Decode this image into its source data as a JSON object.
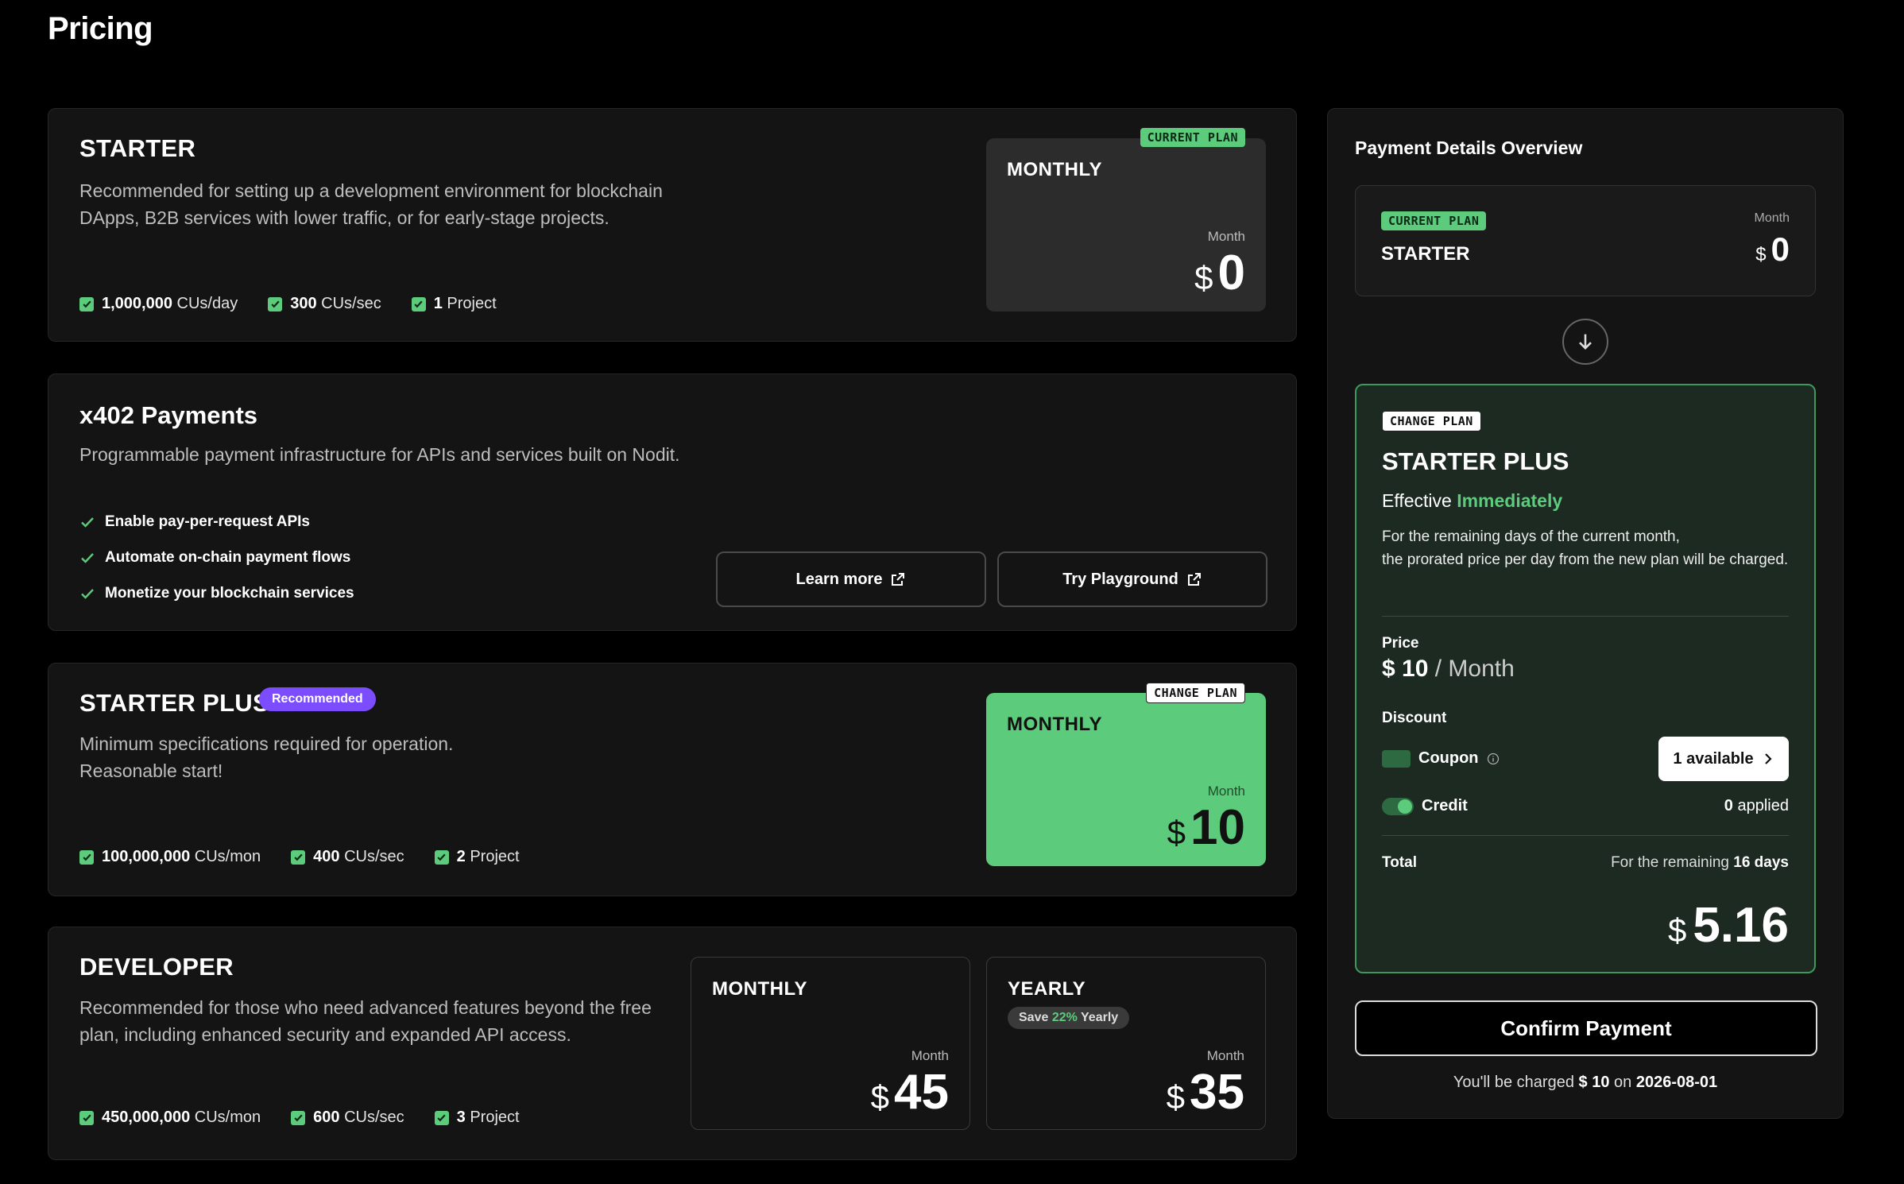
{
  "page": {
    "title": "Pricing"
  },
  "starter": {
    "title": "STARTER",
    "description": "Recommended for setting up a development environment for blockchain DApps, B2B services with lower traffic, or for early-stage projects.",
    "features": [
      {
        "strong": "1,000,000",
        "rest": " CUs/day"
      },
      {
        "strong": "300",
        "rest": " CUs/sec"
      },
      {
        "strong": "1",
        "rest": " Project"
      }
    ],
    "tag": "CURRENT PLAN",
    "period": "MONTHLY",
    "unit": "Month",
    "currency": "$",
    "price": "0"
  },
  "x402": {
    "title": "x402 Payments",
    "description": "Programmable payment infrastructure for APIs and services built on Nodit.",
    "items": [
      "Enable pay-per-request APIs",
      "Automate on-chain payment flows",
      "Monetize your blockchain services"
    ],
    "learn_more": "Learn more",
    "try_playground": "Try Playground"
  },
  "starter_plus": {
    "title": "STARTER PLUS",
    "badge": "Recommended",
    "description_line1": "Minimum specifications required for operation.",
    "description_line2": "Reasonable start!",
    "features": [
      {
        "strong": "100,000,000",
        "rest": " CUs/mon"
      },
      {
        "strong": "400",
        "rest": " CUs/sec"
      },
      {
        "strong": "2",
        "rest": " Project"
      }
    ],
    "tag": "CHANGE PLAN",
    "period": "MONTHLY",
    "unit": "Month",
    "currency": "$",
    "price": "10"
  },
  "developer": {
    "title": "DEVELOPER",
    "description": "Recommended for those who need advanced features beyond the free plan, including enhanced security and expanded API access.",
    "features": [
      {
        "strong": "450,000,000",
        "rest": " CUs/mon"
      },
      {
        "strong": "600",
        "rest": " CUs/sec"
      },
      {
        "strong": "3",
        "rest": " Project"
      }
    ],
    "monthly": {
      "period": "MONTHLY",
      "unit": "Month",
      "currency": "$",
      "price": "45"
    },
    "yearly": {
      "period": "YEARLY",
      "save_prefix": "Save ",
      "save_pct": "22%",
      "save_suffix": " Yearly",
      "unit": "Month",
      "currency": "$",
      "price": "35"
    }
  },
  "summary": {
    "title": "Payment Details Overview",
    "current": {
      "tag": "CURRENT PLAN",
      "plan": "STARTER",
      "unit": "Month",
      "currency": "$",
      "price": "0"
    },
    "change": {
      "tag": "CHANGE PLAN",
      "plan": "STARTER PLUS",
      "effective_label": "Effective",
      "effective_value": "Immediately",
      "note_line1": "For the remaining days of the current month,",
      "note_line2": "the prorated price per day from the new plan will be charged.",
      "price_label": "Price",
      "price_currency": "$",
      "price_value": "10",
      "price_period": "/ Month",
      "discount_label": "Discount",
      "coupon_label": "Coupon",
      "coupon_button": "1 available",
      "credit_label": "Credit",
      "credit_value": "0",
      "credit_suffix": "applied",
      "total_label": "Total",
      "remaining_prefix": "For the remaining",
      "remaining_days": "16 days",
      "total_currency": "$",
      "total_value": "5.16"
    },
    "confirm_button": "Confirm Payment",
    "charge_prefix": "You'll be charged",
    "charge_amount": "$ 10",
    "charge_on": "on",
    "charge_date": "2026-08-01"
  },
  "colors": {
    "accent_green": "#5ccb7c",
    "badge_purple": "#7c4dff",
    "card_bg": "#141414"
  },
  "icons": [
    "check-icon",
    "external-link-icon",
    "arrow-down-icon",
    "chevron-right-icon",
    "info-icon",
    "coupon-icon",
    "credit-toggle-icon"
  ]
}
